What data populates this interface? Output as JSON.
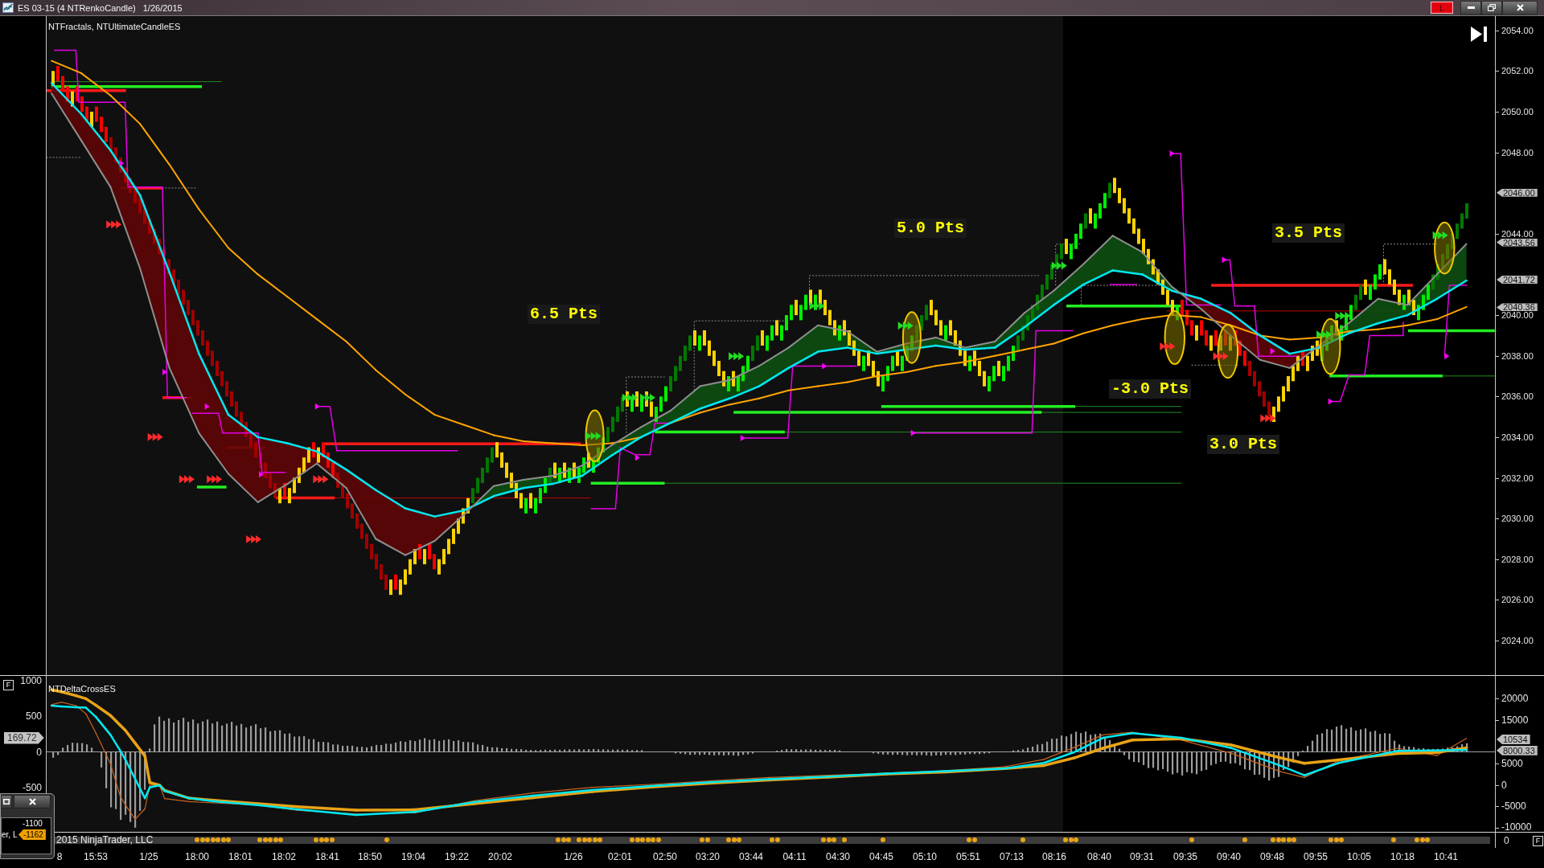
{
  "window": {
    "title": "ES 03-15 (4 NTRenkoCandle)",
    "date": "1/26/2015",
    "link_button": "L"
  },
  "price_panel": {
    "indicators": "NTFractals, NTUltimateCandleES",
    "axis_labels": [
      "2054.00",
      "2052.00",
      "2050.00",
      "2048.00",
      "2044.00",
      "2040.00",
      "2038.00",
      "2036.00",
      "2034.00",
      "2032.00",
      "2030.00",
      "2028.00",
      "2026.00",
      "2024.00"
    ],
    "price_badges": [
      "2046.00",
      "2043.56",
      "2041.72",
      "2040.36"
    ],
    "annotations": [
      "6.5 Pts",
      "5.0 Pts",
      "3.5 Pts",
      "-3.0 Pts",
      "3.0 Pts"
    ]
  },
  "indicator_panel": {
    "format_button": "F",
    "indicator": "NTDeltaCrossES",
    "left_axis_labels": [
      "1000",
      "500",
      "0",
      "-500"
    ],
    "left_badge": "169.72",
    "right_axis_labels": [
      "20000",
      "15000",
      "5000",
      "0",
      "-5000",
      "-10000"
    ],
    "right_badges": [
      "10534",
      "8000.33"
    ]
  },
  "event_strip": {
    "copyright": "2015 NinjaTrader, LLC",
    "axis_label": "0",
    "format_button": "F"
  },
  "time_axis": {
    "labels": [
      "8",
      "15:53",
      "1/25",
      "18:00",
      "18:01",
      "18:02",
      "18:41",
      "18:50",
      "19:04",
      "19:22",
      "20:02",
      "1/26",
      "02:01",
      "02:50",
      "03:20",
      "03:44",
      "04:11",
      "04:30",
      "04:45",
      "05:10",
      "05:51",
      "07:13",
      "08:16",
      "08:40",
      "09:31",
      "09:35",
      "09:40",
      "09:48",
      "09:55",
      "10:05",
      "10:18",
      "10:41"
    ]
  },
  "mini_window": {
    "text": "er, L",
    "axis_label": "-1100",
    "badge": "-1162"
  }
}
